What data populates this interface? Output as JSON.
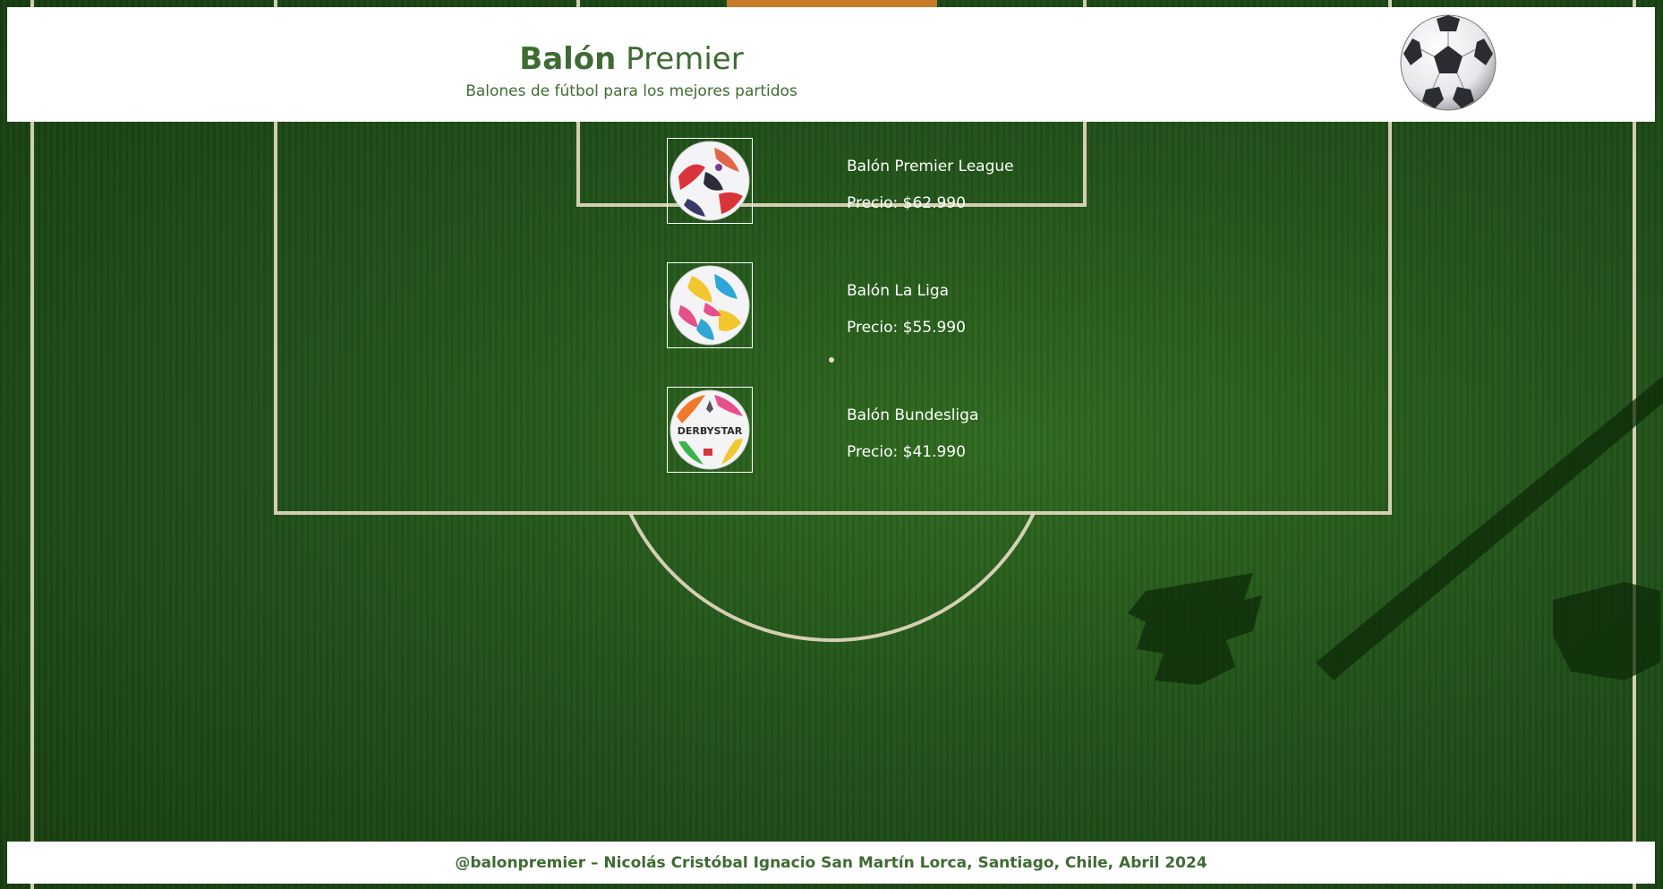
{
  "header": {
    "title_bold": "Balón",
    "title_rest": " Premier",
    "subtitle": "Balones de fútbol para los mejores partidos",
    "logo_icon": "soccer-ball-icon"
  },
  "products": [
    {
      "name": "Balón Premier League",
      "price": "Precio: $62.990",
      "icon": "premier-league-ball-icon",
      "accent": "#d9343b"
    },
    {
      "name": "Balón La Liga",
      "price": "Precio: $55.990",
      "icon": "la-liga-ball-icon",
      "accent": "#2fa6d6"
    },
    {
      "name": "Balón Bundesliga",
      "price": "Precio: $41.990",
      "icon": "bundesliga-ball-icon",
      "accent": "#f07a2a",
      "ball_print": "DERBYSTAR"
    }
  ],
  "footer": {
    "text": "@balonpremier – Nicolás Cristóbal Ignacio San Martín Lorca, Santiago, Chile, Abril 2024"
  },
  "colors": {
    "brand_green": "#3f6b33",
    "field_green": "#22531a",
    "line_white": "#e8dcc4"
  }
}
